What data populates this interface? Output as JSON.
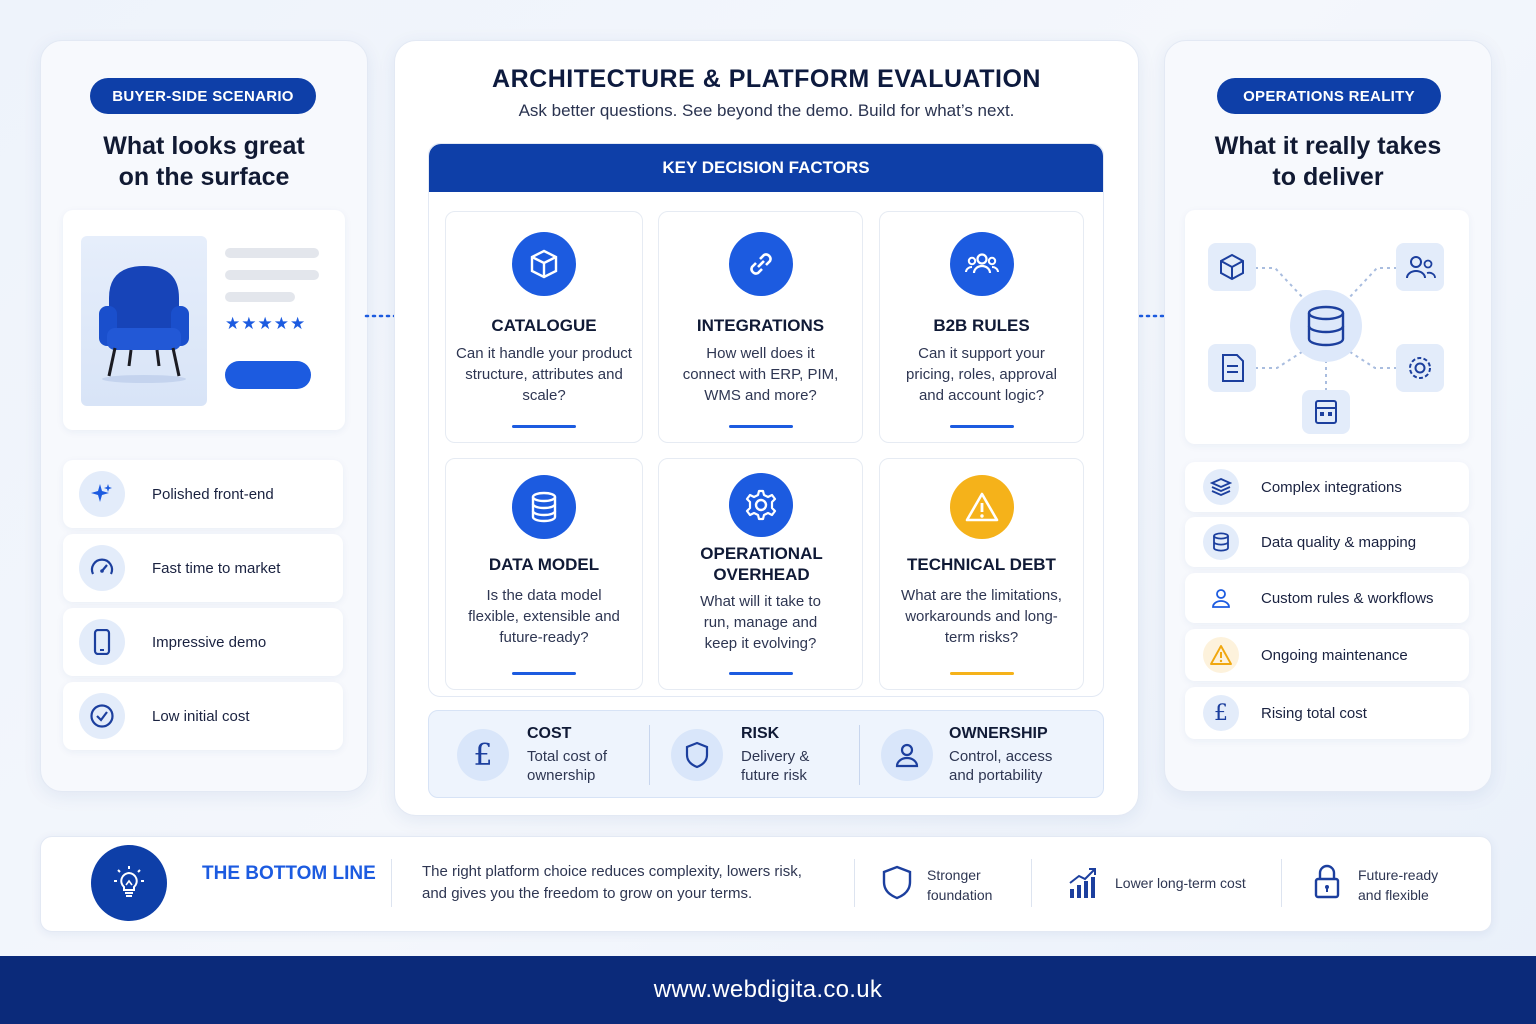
{
  "left": {
    "pill": "BUYER-SIDE SCENARIO",
    "title": "What looks great\non the surface",
    "items": [
      {
        "label": "Polished front-end",
        "icon": "sparkle-icon"
      },
      {
        "label": "Fast time to market",
        "icon": "speedometer-icon"
      },
      {
        "label": "Impressive demo",
        "icon": "phone-icon"
      },
      {
        "label": "Low initial cost",
        "icon": "check-circle-icon"
      }
    ],
    "rating": "★★★★★"
  },
  "center": {
    "title": "ARCHITECTURE & PLATFORM EVALUATION",
    "subtitle": "Ask better questions. See beyond the demo. Build for what’s next.",
    "kdf_header": "KEY DECISION FACTORS",
    "factors": [
      {
        "title": "CATALOGUE",
        "desc": "Can it handle your product structure, attributes and scale?",
        "icon": "cube-icon",
        "color": "#1c5be0"
      },
      {
        "title": "INTEGRATIONS",
        "desc": "How well does it connect with ERP, PIM, WMS and more?",
        "icon": "link-icon",
        "color": "#1c5be0"
      },
      {
        "title": "B2B RULES",
        "desc": "Can it support your pricing, roles, approval and account logic?",
        "icon": "users-icon",
        "color": "#1c5be0"
      },
      {
        "title": "DATA MODEL",
        "desc": "Is the data model flexible, extensible and future-ready?",
        "icon": "database-icon",
        "color": "#1c5be0"
      },
      {
        "title": "OPERATIONAL OVERHEAD",
        "desc": "What will it take to run, manage and keep it evolving?",
        "icon": "gear-icon",
        "color": "#1c5be0"
      },
      {
        "title": "TECHNICAL DEBT",
        "desc": "What are the limitations, workarounds and long-term risks?",
        "icon": "warning-icon",
        "color": "#f5b21a"
      }
    ],
    "summary": [
      {
        "title": "COST",
        "desc": "Total cost of ownership",
        "icon": "pound-icon"
      },
      {
        "title": "RISK",
        "desc": "Delivery & future risk",
        "icon": "shield-icon"
      },
      {
        "title": "OWNERSHIP",
        "desc": "Control, access and portability",
        "icon": "person-icon"
      }
    ]
  },
  "right": {
    "pill": "OPERATIONS REALITY",
    "title": "What it really takes\nto deliver",
    "items": [
      {
        "label": "Complex integrations",
        "icon": "layers-icon"
      },
      {
        "label": "Data quality & mapping",
        "icon": "database-icon"
      },
      {
        "label": "Custom rules & workflows",
        "icon": "person-icon"
      },
      {
        "label": "Ongoing maintenance",
        "icon": "warning-icon"
      },
      {
        "label": "Rising total cost",
        "icon": "pound-icon"
      }
    ]
  },
  "bottom": {
    "title": "THE BOTTOM LINE",
    "text": "The right platform choice reduces complexity, lowers risk, and gives you the freedom to grow on your terms.",
    "benefits": [
      {
        "label": "Stronger foundation",
        "icon": "shield-icon"
      },
      {
        "label": "Lower long-term cost",
        "icon": "chart-up-icon"
      },
      {
        "label": "Future-ready and flexible",
        "icon": "lock-icon"
      }
    ]
  },
  "footer": {
    "url": "www.webdigita.co.uk"
  },
  "colors": {
    "navy": "#0e3fa8",
    "blue": "#1c5be0",
    "amber": "#f5b21a",
    "footer": "#0b2a7a"
  }
}
